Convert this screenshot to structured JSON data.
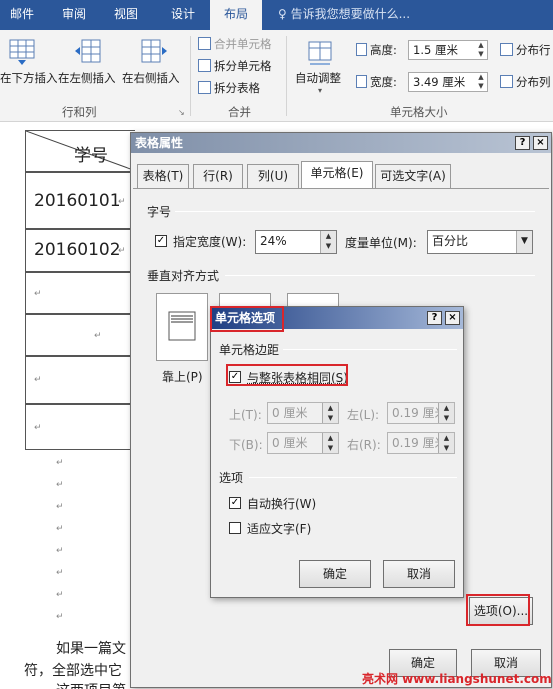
{
  "ribbon": {
    "tabs": [
      "邮件",
      "审阅",
      "视图",
      "设计",
      "布局"
    ],
    "active_tab": "布局",
    "tell_me": "告诉我您想要做什么...",
    "rows_cols": {
      "insert_below": "在下方插入",
      "insert_left": "在左侧插入",
      "insert_right": "在右侧插入",
      "group_label": "行和列"
    },
    "merge": {
      "merge_cells": "合并单元格",
      "split_cells": "拆分单元格",
      "split_table": "拆分表格",
      "group_label": "合并"
    },
    "cell_size": {
      "autofit": "自动调整",
      "height_label": "高度:",
      "height_value": "1.5 厘米",
      "width_label": "宽度:",
      "width_value": "3.49 厘米",
      "dist_rows": "分布行",
      "dist_cols": "分布列",
      "group_label": "单元格大小"
    }
  },
  "document": {
    "header_cell": "学号",
    "rows": [
      "20160101",
      "20160102",
      "",
      "",
      "",
      ""
    ],
    "paragraph_line1": "如果一篇文",
    "paragraph_line2": "符，全部选中它",
    "paragraph_line3": "这两项目第"
  },
  "table_props": {
    "title": "表格属性",
    "help": "?",
    "close": "×",
    "tabs": [
      "表格(T)",
      "行(R)",
      "列(U)",
      "单元格(E)",
      "可选文字(A)"
    ],
    "active_tab": "单元格(E)",
    "size_section": "字号",
    "preferred_width_label": "指定宽度(W):",
    "preferred_width_checked": true,
    "preferred_width_value": "24%",
    "measure_label": "度量单位(M):",
    "measure_value": "百分比",
    "valign_section": "垂直对齐方式",
    "valign_top_label": "靠上(P)",
    "options_button": "选项(O)...",
    "ok": "确定",
    "cancel": "取消"
  },
  "cell_options": {
    "title": "单元格选项",
    "help": "?",
    "close": "×",
    "margins_section": "单元格边距",
    "same_as_table_label": "与整张表格相同(S)",
    "same_as_table_checked": true,
    "top_label": "上(T):",
    "top_value": "0 厘米",
    "left_label": "左(L):",
    "left_value": "0.19 厘米",
    "bottom_label": "下(B):",
    "bottom_value": "0 厘米",
    "right_label": "右(R):",
    "right_value": "0.19 厘米",
    "options_section": "选项",
    "wrap_label": "自动换行(W)",
    "wrap_checked": true,
    "fit_label": "适应文字(F)",
    "fit_checked": false,
    "ok": "确定",
    "cancel": "取消"
  },
  "watermark": "亮术网 www.liangshunet.com",
  "colors": {
    "ribbon_blue": "#2b579a",
    "highlight_red": "#d9262b",
    "title_active": "#1f3f83"
  }
}
